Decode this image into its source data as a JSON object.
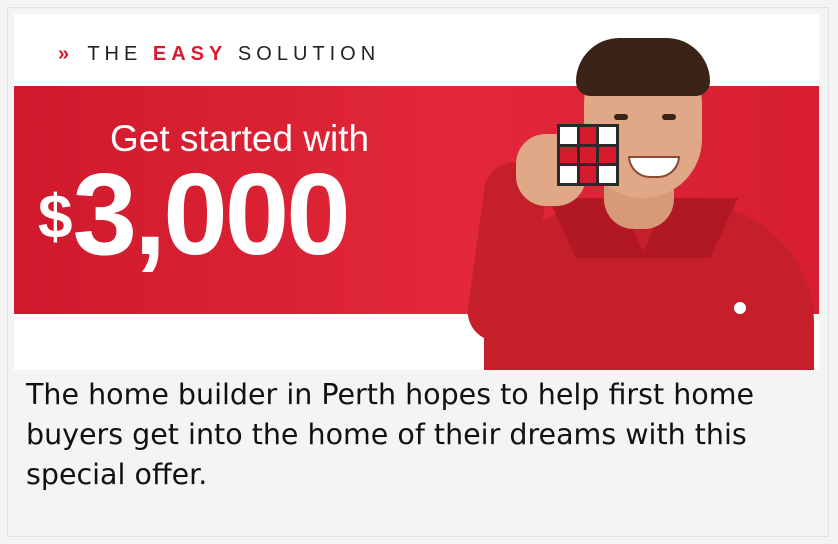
{
  "banner": {
    "tagline_prefix": "»",
    "tagline_the": "THE",
    "tagline_easy": "EASY",
    "tagline_solution": "SOLUTION",
    "headline": "Get started with",
    "currency": "$",
    "amount": "3,000",
    "colors": {
      "brand_red": "#d81a2e"
    }
  },
  "caption": {
    "text": "The home builder in Perth hopes to help first home buyers get into the home of their dreams with this special offer."
  }
}
